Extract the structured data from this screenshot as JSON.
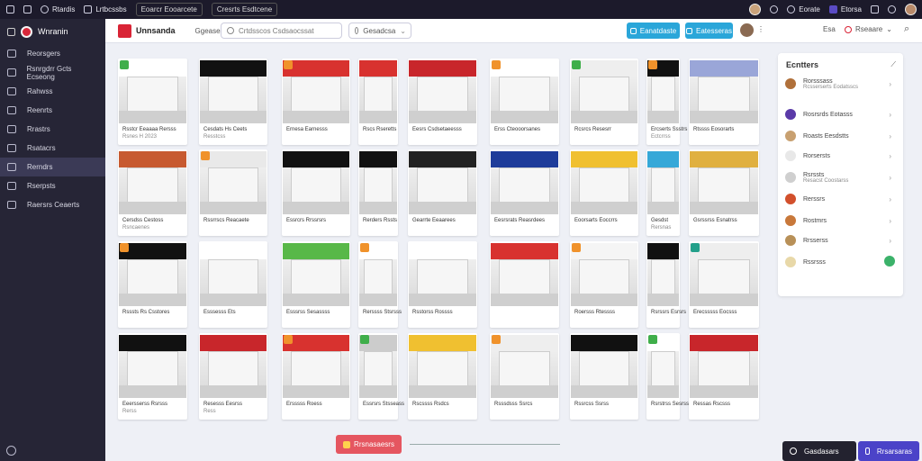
{
  "topbar": {
    "items": [
      "Rtardis",
      "Lrtbcssbs",
      "Eoarcr Eooarcete",
      "Cresrts Esdtcene"
    ],
    "right_label": "Eorate",
    "right_label2": "Etorsa"
  },
  "sidebar": {
    "logo_text": "Wnranin",
    "items": [
      {
        "label": "Reorsgers",
        "active": false
      },
      {
        "label": "Rsnrgdrr Gcts Ecseong",
        "active": false
      },
      {
        "label": "Rahwss",
        "active": false
      },
      {
        "label": "Reenrts",
        "active": false
      },
      {
        "label": "Rrastrs",
        "active": false
      },
      {
        "label": "Rsatacrs",
        "active": false
      },
      {
        "label": "Rerndrs",
        "active": true
      },
      {
        "label": "Rserpsts",
        "active": false
      },
      {
        "label": "Raersrs Ceaerts",
        "active": false
      }
    ]
  },
  "header": {
    "brand": "Unnsanda",
    "subtitle": "Ggeasesd Fd",
    "search_placeholder": "Crtdsscos Csdsaocssat",
    "select_value": "Gesadcsa",
    "btn1_label": "Eanatdaste",
    "btn2_label": "Eatesseras",
    "right_a": "Esa",
    "right_b": "Rseaare"
  },
  "cards": [
    {
      "cap": "Rsstcr Eeaaaa Rersss",
      "cap2": "Rsnes H 2023",
      "accent": "#3fae4a",
      "wall": "#ffffff"
    },
    {
      "cap": "Cesdats Hs Ceets",
      "cap2": "Resstcss",
      "accent": "",
      "wall": "#111111"
    },
    {
      "cap": "Ernesa Earnesss",
      "cap2": "",
      "accent": "#f0922b",
      "wall": "#d8322f"
    },
    {
      "cap": "Rscs Rseretts",
      "cap2": "",
      "accent": "",
      "wall": "#d8322f"
    },
    {
      "cap": "Eesrs Csdsetaeesss",
      "cap2": "",
      "accent": "",
      "wall": "#c8262b"
    },
    {
      "cap": "Erss Cteooorsanes",
      "cap2": "",
      "accent": "#f0922b",
      "wall": "#ffffff"
    },
    {
      "cap": "Rcsrcs Resesrr",
      "cap2": "",
      "accent": "#3fae4a",
      "wall": "#eeeeee"
    },
    {
      "cap": "Ercserts Ssstrs",
      "cap2": "Ectcrrss",
      "accent": "#f0922b",
      "wall": "#111111"
    },
    {
      "cap": "Rtssss Eosorarts",
      "cap2": "",
      "accent": "",
      "wall": "#9aa6d8"
    },
    {
      "cap": "Cersdss Cestoss",
      "cap2": "Rsncaenes",
      "accent": "",
      "wall": "#c75a30"
    },
    {
      "cap": "Rssrrscs Reacaete",
      "cap2": "",
      "accent": "#f0922b",
      "wall": "#e9e9e9"
    },
    {
      "cap": "Essrcrs Rrssrsrs",
      "cap2": "",
      "accent": "",
      "wall": "#111111"
    },
    {
      "cap": "Rerders Rssts",
      "cap2": "",
      "accent": "",
      "wall": "#111111"
    },
    {
      "cap": "Gearrte Eeaarees",
      "cap2": "",
      "accent": "",
      "wall": "#222222"
    },
    {
      "cap": "Eesrsrats Reasrdees",
      "cap2": "",
      "accent": "",
      "wall": "#1e3c9a"
    },
    {
      "cap": "Eoorsarts Eoccrrs",
      "cap2": "",
      "accent": "",
      "wall": "#f0c030"
    },
    {
      "cap": "Gesdst",
      "cap2": "Rersnas",
      "accent": "",
      "wall": "#36a8d8"
    },
    {
      "cap": "Gsrssrss Esnatrss",
      "cap2": "",
      "accent": "",
      "wall": "#e0b040"
    },
    {
      "cap": "Rsssts Rs Csstores",
      "cap2": "",
      "accent": "#f0922b",
      "wall": "#111111"
    },
    {
      "cap": "Esssesss Ets",
      "cap2": "",
      "accent": "",
      "wall": "#ffffff"
    },
    {
      "cap": "Esssrss Sesassss",
      "cap2": "",
      "accent": "",
      "wall": "#58b848"
    },
    {
      "cap": "Rerssss Stsrsss",
      "cap2": "",
      "accent": "#f0922b",
      "wall": "#ffffff"
    },
    {
      "cap": "Rsstorss Rossss",
      "cap2": "",
      "accent": "",
      "wall": "#ffffff"
    },
    {
      "cap": "",
      "cap2": "",
      "accent": "",
      "wall": "#d8322f"
    },
    {
      "cap": "Roersss Rtessss",
      "cap2": "",
      "accent": "#f0922b",
      "wall": "#f5f5f5"
    },
    {
      "cap": "Rsrssrs Esrsrs",
      "cap2": "",
      "accent": "",
      "wall": "#111111"
    },
    {
      "cap": "Erecsssss Eocsss",
      "cap2": "",
      "accent": "#23a08a",
      "wall": "#eeeeee"
    },
    {
      "cap": "Eeersserss Rsrsss",
      "cap2": "Rerss",
      "accent": "",
      "wall": "#111111"
    },
    {
      "cap": "Resesss Eesrss",
      "cap2": "Ress",
      "accent": "",
      "wall": "#c8262b"
    },
    {
      "cap": "Ersssss Roess",
      "cap2": "",
      "accent": "#f0922b",
      "wall": "#d8322f"
    },
    {
      "cap": "Essrsrs Stsseass",
      "cap2": "",
      "accent": "#3fae4a",
      "wall": "#cccccc"
    },
    {
      "cap": "Rscssss Rsdcs",
      "cap2": "",
      "accent": "",
      "wall": "#f0c030"
    },
    {
      "cap": "Rsssdsss Ssrcs",
      "cap2": "",
      "accent": "#f0922b",
      "wall": "#eeeeee"
    },
    {
      "cap": "Rssrcss Ssrss",
      "cap2": "",
      "accent": "",
      "wall": "#111111"
    },
    {
      "cap": "Rsrstrss Sesrss",
      "cap2": "",
      "accent": "#3fae4a",
      "wall": "#ffffff"
    },
    {
      "cap": "Ressas Rscsss",
      "cap2": "",
      "accent": "",
      "wall": "#c8262b"
    }
  ],
  "right_panel": {
    "title": "Ecntters",
    "items": [
      {
        "label": "Rorsssass",
        "sub": "Rcsserserts Eodatsscs",
        "color": "#b0703a"
      },
      {
        "label": "Rosrsrds Eotasss",
        "sub": "",
        "color": "#5a3aa8"
      },
      {
        "label": "Roasts Eesdstts",
        "sub": "",
        "color": "#c8a070"
      },
      {
        "label": "Rorsersts",
        "sub": "",
        "color": "#e8e8e8"
      },
      {
        "label": "Rsrssts",
        "sub": "Resacst Coostarss",
        "color": "#cfcfcf"
      },
      {
        "label": "Rerssrs",
        "sub": "",
        "color": "#d2502c"
      },
      {
        "label": "Rostmrs",
        "sub": "",
        "color": "#c8783a"
      },
      {
        "label": "Rrsserss",
        "sub": "",
        "color": "#b89058"
      },
      {
        "label": "Rssrsss",
        "sub": "",
        "color": "#e8d8a8"
      }
    ]
  },
  "footer": {
    "load_label": "Rrsnasaesrs",
    "btn_dark": "Gasdasars",
    "btn_purple": "Rrsarsaras"
  },
  "colors": {
    "accent_blue": "#2aa6d9",
    "sidebar": "#262536",
    "brand_red": "#d92436"
  }
}
